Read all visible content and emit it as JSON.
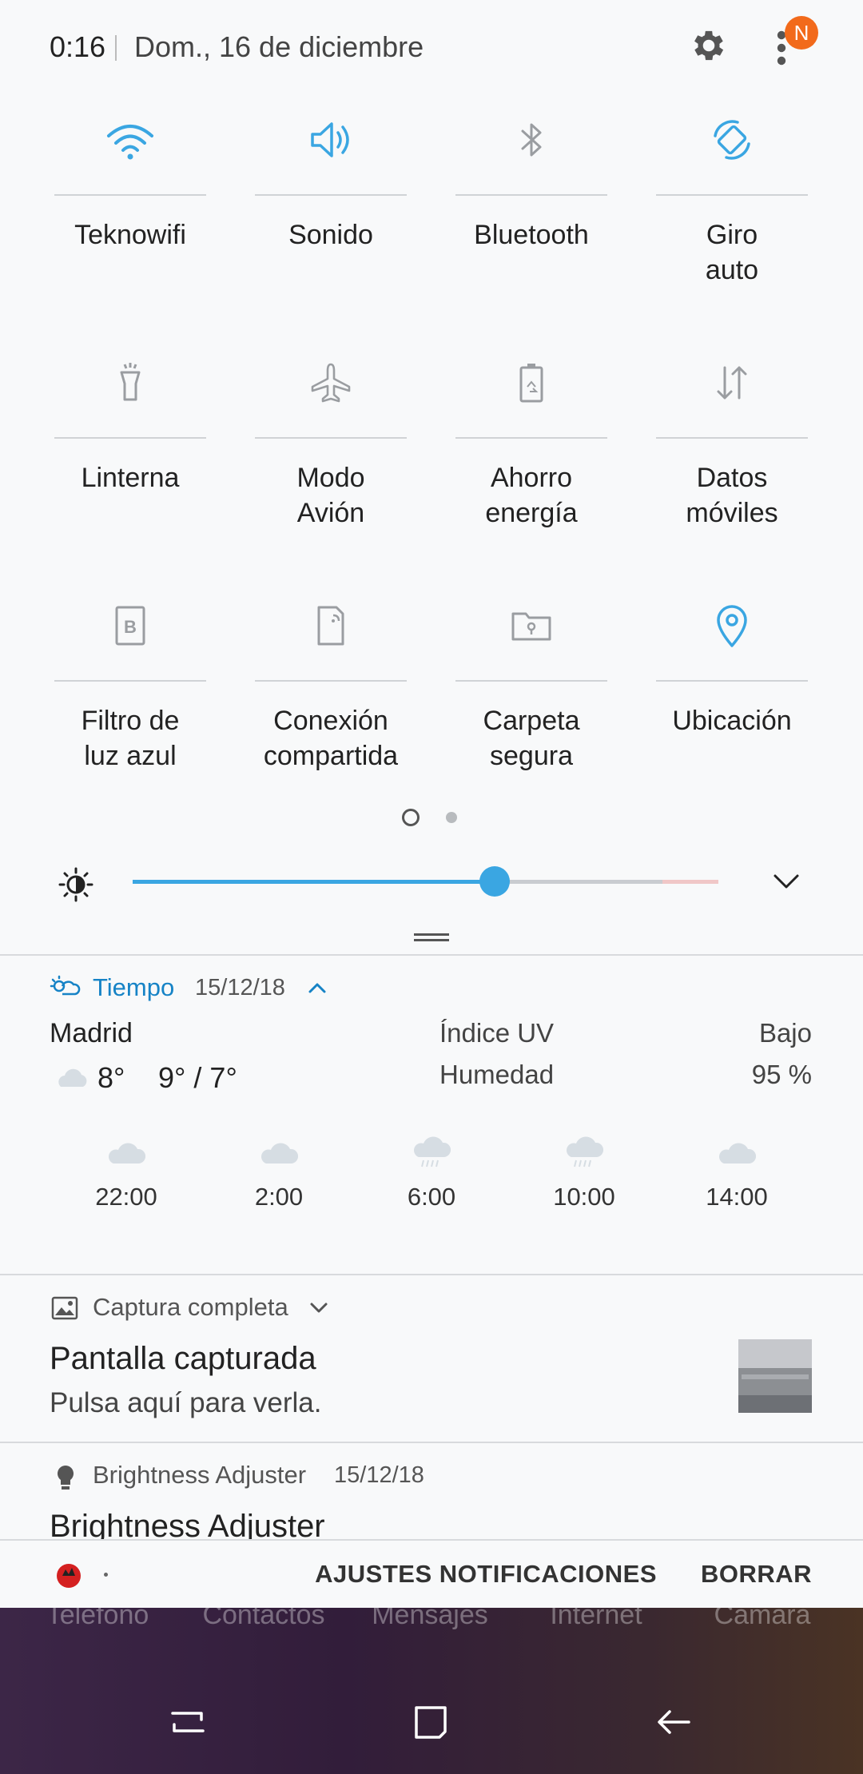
{
  "status": {
    "time": "0:16",
    "date": "Dom., 16 de diciembre",
    "notification_badge": "N",
    "accent": "#3aa6e2",
    "badge_color": "#f26a1b"
  },
  "quick_tiles": [
    {
      "label": "Teknowifi",
      "icon": "wifi-icon",
      "active": true
    },
    {
      "label": "Sonido",
      "icon": "volume-icon",
      "active": true
    },
    {
      "label": "Bluetooth",
      "icon": "bluetooth-icon",
      "active": false
    },
    {
      "label": "Giro\nauto",
      "icon": "rotate-icon",
      "active": true
    },
    {
      "label": "Linterna",
      "icon": "flashlight-icon",
      "active": false
    },
    {
      "label": "Modo\nAvión",
      "icon": "airplane-icon",
      "active": false
    },
    {
      "label": "Ahorro\nenergía",
      "icon": "battery-saver-icon",
      "active": false
    },
    {
      "label": "Datos\nmóviles",
      "icon": "mobile-data-icon",
      "active": false
    },
    {
      "label": "Filtro de\nluz azul",
      "icon": "blue-light-filter-icon",
      "active": false
    },
    {
      "label": "Conexión\ncompartida",
      "icon": "hotspot-icon",
      "active": false
    },
    {
      "label": "Carpeta\nsegura",
      "icon": "secure-folder-icon",
      "active": false
    },
    {
      "label": "Ubicación",
      "icon": "location-icon",
      "active": true
    }
  ],
  "pager": {
    "current": 1,
    "total": 2
  },
  "brightness": {
    "level": 0.65
  },
  "weather": {
    "app": "Tiempo",
    "date": "15/12/18",
    "city": "Madrid",
    "current_temp": "8°",
    "range": "9° / 7°",
    "uv_label": "Índice UV",
    "uv_value": "Bajo",
    "humidity_label": "Humedad",
    "humidity_value": "95 %",
    "forecast": [
      {
        "time": "22:00",
        "icon": "cloud-icon"
      },
      {
        "time": "2:00",
        "icon": "cloud-icon"
      },
      {
        "time": "6:00",
        "icon": "rain-icon"
      },
      {
        "time": "10:00",
        "icon": "rain-icon"
      },
      {
        "time": "14:00",
        "icon": "cloud-icon"
      }
    ]
  },
  "screenshot_notification": {
    "app": "Captura completa",
    "title": "Pantalla capturada",
    "subtitle": "Pulsa aquí para verla."
  },
  "brightness_notification": {
    "app": "Brightness Adjuster",
    "date": "15/12/18",
    "title": "Brightness Adjuster"
  },
  "footer": {
    "settings": "AJUSTES NOTIFICACIONES",
    "clear": "BORRAR"
  },
  "dock": [
    "Teléfono",
    "Contactos",
    "Mensajes",
    "Internet",
    "Cámara"
  ]
}
